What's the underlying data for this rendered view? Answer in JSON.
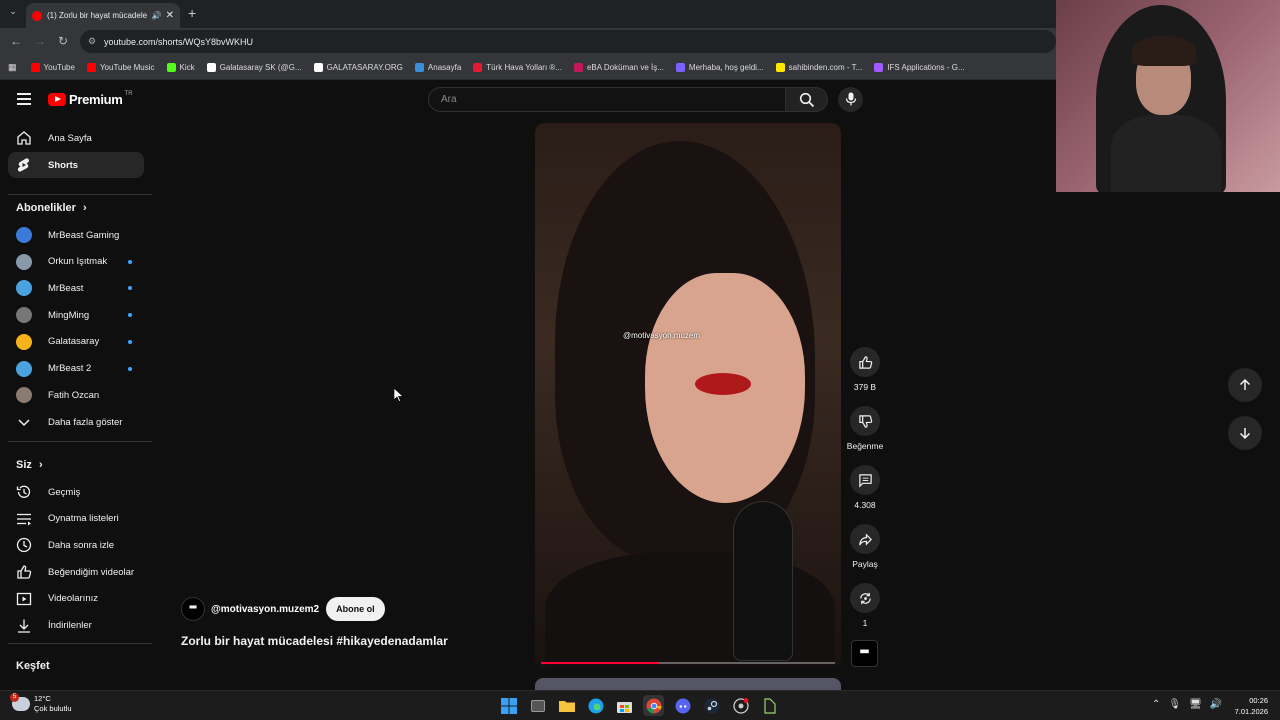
{
  "browser": {
    "tab_title": "(1) Zorlu bir hayat mücadele",
    "url": "youtube.com/shorts/WQsY8bvWKHU",
    "bookmarks": [
      {
        "label": "YouTube",
        "color": "#ff0000"
      },
      {
        "label": "YouTube Music",
        "color": "#ff0000"
      },
      {
        "label": "Kick",
        "color": "#53fc18"
      },
      {
        "label": "Galatasaray SK (@G...",
        "color": "#ffffff"
      },
      {
        "label": "GALATASARAY.ORG",
        "color": "#ffffff"
      },
      {
        "label": "Anasayfa",
        "color": "#3b8fd9"
      },
      {
        "label": "Türk Hava Yolları ®...",
        "color": "#e81932"
      },
      {
        "label": "eBA Doküman ve İş...",
        "color": "#c2185b"
      },
      {
        "label": "Merhaba, hoş geldi...",
        "color": "#7b61ff"
      },
      {
        "label": "sahibinden.com - T...",
        "color": "#ffe800"
      },
      {
        "label": "IFS Applications - G...",
        "color": "#a259ff"
      }
    ]
  },
  "header": {
    "logo": "Premium",
    "region": "TR",
    "search_placeholder": "Ara"
  },
  "sidebar": {
    "main": [
      {
        "label": "Ana Sayfa",
        "icon": "home-icon",
        "active": false
      },
      {
        "label": "Shorts",
        "icon": "shorts-icon",
        "active": true
      }
    ],
    "subs_title": "Abonelikler",
    "subs": [
      {
        "label": "MrBeast Gaming",
        "color": "#3b7ad9",
        "dot": false
      },
      {
        "label": "Orkun Işıtmak",
        "color": "#8899aa",
        "dot": true
      },
      {
        "label": "MrBeast",
        "color": "#4aa3df",
        "dot": true
      },
      {
        "label": "MingMing",
        "color": "#777777",
        "dot": true
      },
      {
        "label": "Galatasaray",
        "color": "#f6b21a",
        "dot": true
      },
      {
        "label": "MrBeast 2",
        "color": "#4aa3df",
        "dot": true
      },
      {
        "label": "Fatih Ozcan",
        "color": "#8a7a70",
        "dot": false
      }
    ],
    "show_more": "Daha fazla göster",
    "you_title": "Siz",
    "you": [
      {
        "label": "Geçmiş",
        "icon": "history-icon"
      },
      {
        "label": "Oynatma listeleri",
        "icon": "playlists-icon"
      },
      {
        "label": "Daha sonra izle",
        "icon": "watch-later-icon"
      },
      {
        "label": "Beğendiğim videolar",
        "icon": "liked-icon"
      },
      {
        "label": "Videolarınız",
        "icon": "your-videos-icon"
      },
      {
        "label": "İndirilenler",
        "icon": "downloads-icon"
      }
    ],
    "explore_title": "Keşfet"
  },
  "short": {
    "watermark": "@motivasyon.muzem",
    "channel": "@motivasyon.muzem2",
    "subscribe": "Abone ol",
    "title": "Zorlu bir hayat mücadelesi #hikayedenadamlar",
    "progress": 0.4,
    "likes": "379 B",
    "dislike": "Beğenme",
    "comments": "4.308",
    "share": "Paylaş",
    "remix": "1"
  },
  "taskbar": {
    "temp": "12°C",
    "weather": "Çok bulutlu",
    "badge": "5",
    "time": "00:26",
    "date": "7.01.2026"
  }
}
